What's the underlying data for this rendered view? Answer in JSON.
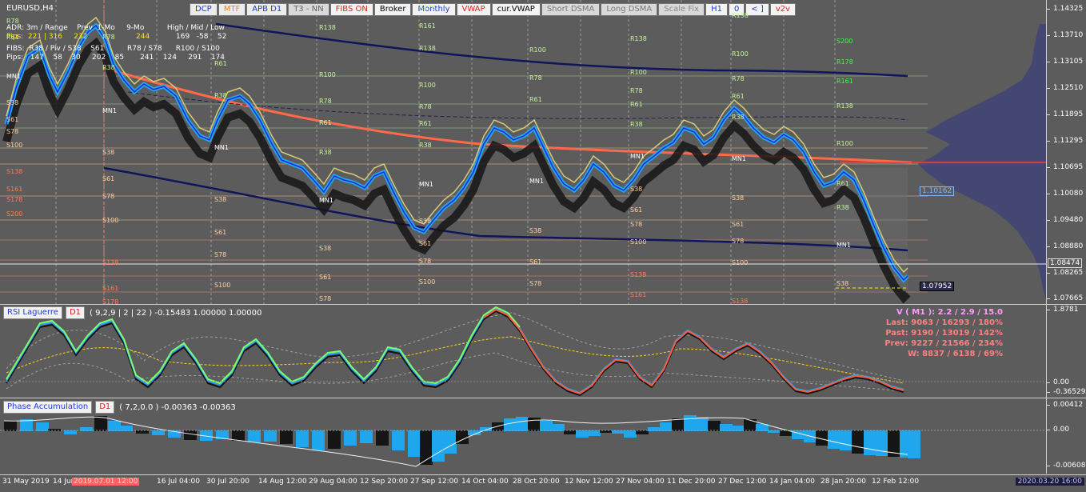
{
  "window": {
    "symbol": "EURUSD,H4"
  },
  "toolbar": [
    "DCP",
    "MTF",
    "APB D1",
    "T3 - NN",
    "FIBS ON",
    "Broker",
    "Monthly",
    "VWAP",
    "cur.VWAP",
    "Short DSMA",
    "Long DSMA",
    "Scale Fix",
    "H1",
    "0",
    "< ]",
    "v2v"
  ],
  "info": {
    "row1": "ADR: 3m / Range    Prev  1-Mo     9-Mo          High / Mid / Low",
    "row2_a": "Pips:  221 | 316     232",
    "row2_b": "244",
    "row2_c": "169   -58    52",
    "row3": "FIBS:  R38 / Piv / S38    S61          R78 / S78      R100 / S100",
    "row4": "Pips:   147    58    30     202    85       241    124     291    174"
  },
  "price_scale": [
    "1.14325",
    "1.13710",
    "1.13105",
    "1.12510",
    "1.11895",
    "1.11295",
    "1.10695",
    "1.10080",
    "1.09480",
    "1.08880",
    "1.08265",
    "1.07665"
  ],
  "price_tags": {
    "current": "1.08474",
    "vwap": "1.10162",
    "low": "1.07952"
  },
  "rsi": {
    "title": "RSI Laguerre",
    "tf": "D1",
    "params": "( 9,2,9 | 2 | 22 ) -0.15483 1.00000 1.00000",
    "scale": [
      "1.8781",
      "0.00",
      "-0.36529"
    ],
    "stats": {
      "v": "V ( M1 ): 2.2 / 2.9 / 15.0",
      "last": "Last: 9063 / 16293 / 180%",
      "past": "Past: 9190 / 13019 / 142%",
      "prev": "Prev: 9227 / 21566 / 234%",
      "w": "W: 8837 / 6138 / 69%"
    }
  },
  "phase": {
    "title": "Phase Accumulation",
    "tf": "D1",
    "params": "( 7,2,0.0 ) -0.00363 -0.00363",
    "scale": [
      "0.00412",
      "0.00",
      "-0.00608"
    ]
  },
  "xaxis": [
    "31 May 2019",
    "14 Jun",
    "2019.07.01 12:00",
    "16 Jul 04:00",
    "30 Jul 20:00",
    "14 Aug 12:00",
    "29 Aug 04:00",
    "12 Sep 20:00",
    "27 Sep 12:00",
    "14 Oct 04:00",
    "28 Oct 20:00",
    "12 Nov 12:00",
    "27 Nov 04:00",
    "11 Dec 20:00",
    "27 Dec 12:00",
    "14 Jan 04:00",
    "28 Jan 20:00",
    "12 Feb 12:00"
  ],
  "date_badge": "2020.03.20 16:00",
  "levels": [
    {
      "text": "R78",
      "c": "g"
    },
    {
      "text": "R61",
      "c": "g"
    },
    {
      "text": "MN1",
      "c": "w"
    },
    {
      "text": "S38",
      "c": "o"
    },
    {
      "text": "S61",
      "c": "o"
    },
    {
      "text": "S78",
      "c": "o"
    },
    {
      "text": "S100",
      "c": "o"
    },
    {
      "text": "S138",
      "c": "r"
    },
    {
      "text": "S161",
      "c": "r"
    },
    {
      "text": "S178",
      "c": "r"
    },
    {
      "text": "S200",
      "c": "r"
    },
    {
      "text": "R78",
      "c": "g"
    },
    {
      "text": "R38",
      "c": "g"
    },
    {
      "text": "MN1",
      "c": "w"
    },
    {
      "text": "S38",
      "c": "o"
    },
    {
      "text": "S61",
      "c": "o"
    },
    {
      "text": "S78",
      "c": "o"
    },
    {
      "text": "S100",
      "c": "o"
    },
    {
      "text": "S138",
      "c": "r"
    },
    {
      "text": "S161",
      "c": "r"
    },
    {
      "text": "S178",
      "c": "r"
    },
    {
      "text": "R61",
      "c": "g"
    },
    {
      "text": "R38",
      "c": "g"
    },
    {
      "text": "MN1",
      "c": "w"
    },
    {
      "text": "S38",
      "c": "o"
    },
    {
      "text": "S61",
      "c": "o"
    },
    {
      "text": "S78",
      "c": "o"
    },
    {
      "text": "S100",
      "c": "o"
    },
    {
      "text": "R138",
      "c": "g"
    },
    {
      "text": "R100",
      "c": "g"
    },
    {
      "text": "R78",
      "c": "g"
    },
    {
      "text": "R61",
      "c": "g"
    },
    {
      "text": "R38",
      "c": "g"
    },
    {
      "text": "MN1",
      "c": "w"
    },
    {
      "text": "S38",
      "c": "o"
    },
    {
      "text": "S61",
      "c": "o"
    },
    {
      "text": "S78",
      "c": "o"
    },
    {
      "text": "R178",
      "c": "g"
    },
    {
      "text": "R161",
      "c": "g"
    },
    {
      "text": "R138",
      "c": "g"
    },
    {
      "text": "R100",
      "c": "g"
    },
    {
      "text": "R78",
      "c": "g"
    },
    {
      "text": "R61",
      "c": "g"
    },
    {
      "text": "R38",
      "c": "g"
    },
    {
      "text": "MN1",
      "c": "w"
    },
    {
      "text": "S38",
      "c": "o"
    },
    {
      "text": "S61",
      "c": "o"
    },
    {
      "text": "S78",
      "c": "o"
    },
    {
      "text": "S100",
      "c": "o"
    },
    {
      "text": "R100",
      "c": "g"
    },
    {
      "text": "R78",
      "c": "g"
    },
    {
      "text": "R61",
      "c": "g"
    },
    {
      "text": "MN1",
      "c": "w"
    },
    {
      "text": "S38",
      "c": "o"
    },
    {
      "text": "S61",
      "c": "o"
    },
    {
      "text": "S78",
      "c": "o"
    },
    {
      "text": "R138",
      "c": "g"
    },
    {
      "text": "R100",
      "c": "g"
    },
    {
      "text": "R78",
      "c": "g"
    },
    {
      "text": "R61",
      "c": "g"
    },
    {
      "text": "R38",
      "c": "g"
    },
    {
      "text": "MN1",
      "c": "w"
    },
    {
      "text": "S38",
      "c": "o"
    },
    {
      "text": "S61",
      "c": "o"
    },
    {
      "text": "S78",
      "c": "o"
    },
    {
      "text": "S100",
      "c": "o"
    },
    {
      "text": "S138",
      "c": "r"
    },
    {
      "text": "S161",
      "c": "r"
    },
    {
      "text": "R138",
      "c": "g"
    },
    {
      "text": "R100",
      "c": "g"
    },
    {
      "text": "R78",
      "c": "g"
    },
    {
      "text": "R61",
      "c": "g"
    },
    {
      "text": "R38",
      "c": "g"
    },
    {
      "text": "MN1",
      "c": "w"
    },
    {
      "text": "S38",
      "c": "o"
    },
    {
      "text": "S61",
      "c": "o"
    },
    {
      "text": "S78",
      "c": "o"
    },
    {
      "text": "S100",
      "c": "o"
    },
    {
      "text": "S138",
      "c": "r"
    },
    {
      "text": "S200",
      "c": "dg"
    },
    {
      "text": "R178",
      "c": "dg"
    },
    {
      "text": "R161",
      "c": "dg"
    },
    {
      "text": "R138",
      "c": "g"
    },
    {
      "text": "R100",
      "c": "g"
    },
    {
      "text": "R61",
      "c": "g"
    },
    {
      "text": "R38",
      "c": "g"
    },
    {
      "text": "MN1",
      "c": "w"
    },
    {
      "text": "S38",
      "c": "o"
    }
  ],
  "chart_data": {
    "type": "line",
    "series": [],
    "rsi_series": [],
    "phase_series": []
  }
}
